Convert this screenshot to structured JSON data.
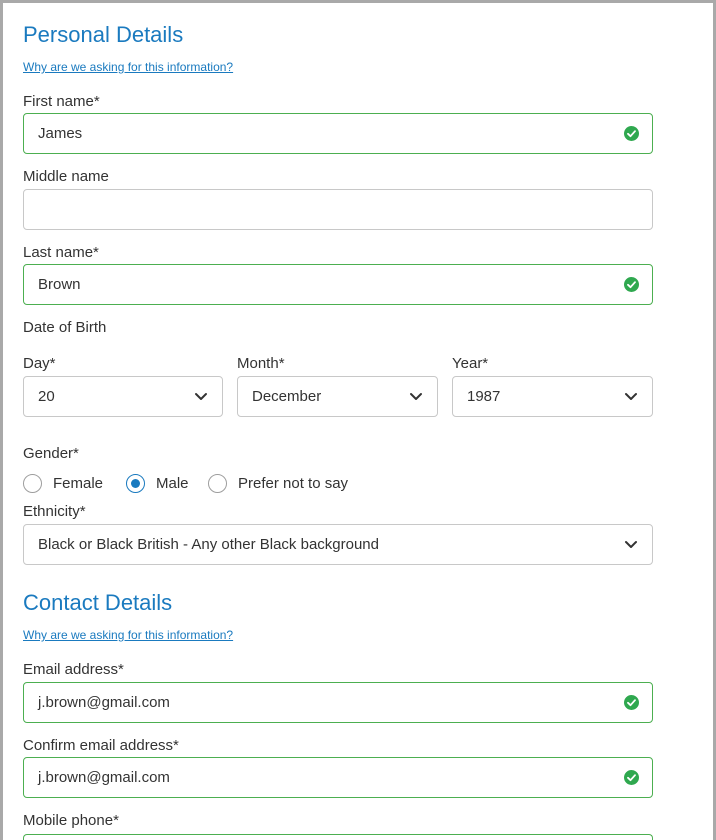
{
  "personal": {
    "heading": "Personal Details",
    "why_link": "Why are we asking for this information?",
    "first_name": {
      "label": "First name*",
      "value": "James"
    },
    "middle_name": {
      "label": "Middle name",
      "value": ""
    },
    "last_name": {
      "label": "Last name*",
      "value": "Brown"
    },
    "dob": {
      "label": "Date of Birth",
      "day": {
        "label": "Day*",
        "value": "20"
      },
      "month": {
        "label": "Month*",
        "value": "December"
      },
      "year": {
        "label": "Year*",
        "value": "1987"
      }
    },
    "gender": {
      "label": "Gender*",
      "options": [
        "Female",
        "Male",
        "Prefer not to say"
      ],
      "selected": "Male"
    },
    "ethnicity": {
      "label": "Ethnicity*",
      "value": "Black or Black British - Any other Black background"
    }
  },
  "contact": {
    "heading": "Contact Details",
    "why_link": "Why are we asking for this information?",
    "email": {
      "label": "Email address*",
      "value": "j.brown@gmail.com"
    },
    "confirm_email": {
      "label": "Confirm email address*",
      "value": "j.brown@gmail.com"
    },
    "mobile": {
      "label": "Mobile phone*"
    }
  },
  "colors": {
    "accent": "#1a7abf",
    "valid_border": "#4caf50",
    "check": "#2fa84f"
  },
  "icons": [
    "check-circle-icon",
    "chevron-down-icon"
  ]
}
